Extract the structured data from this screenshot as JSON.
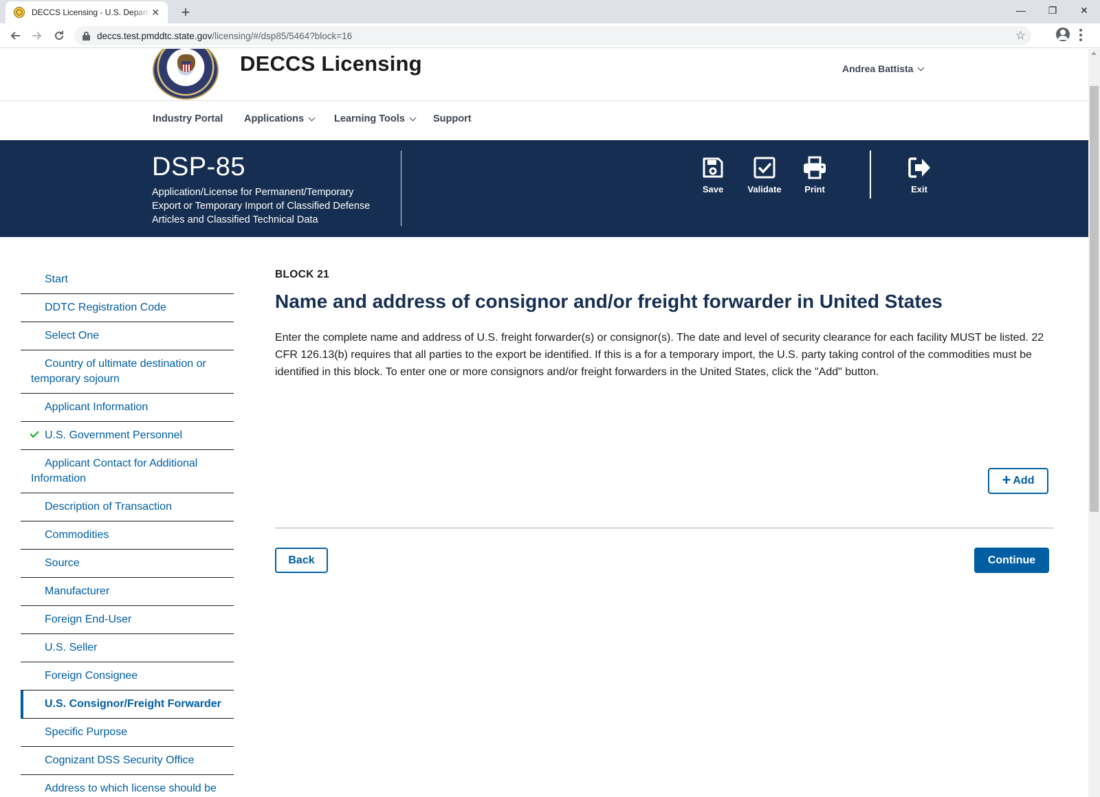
{
  "browser": {
    "tab_title": "DECCS Licensing - U.S. Department of State",
    "tab_close": "✕",
    "new_tab": "+",
    "url_host": "deccs.test.pmddtc.state.gov",
    "url_path": "/licensing/#/dsp85/5464?block=16",
    "window_controls": [
      "—",
      "❐",
      "✕"
    ]
  },
  "header": {
    "site_title": "DECCS Licensing",
    "user_name": "Andrea Battista"
  },
  "nav": {
    "items": [
      {
        "label": "Industry Portal",
        "dropdown": false
      },
      {
        "label": "Applications",
        "dropdown": true
      },
      {
        "label": "Learning Tools",
        "dropdown": true
      },
      {
        "label": "Support",
        "dropdown": false
      }
    ]
  },
  "banner": {
    "form_code": "DSP-85",
    "form_description": "Application/License for Permanent/Temporary Export or Temporary Import of Classified Defense Articles and Classified Technical Data",
    "actions": {
      "save": "Save",
      "validate": "Validate",
      "print": "Print",
      "exit": "Exit"
    }
  },
  "sidenav": {
    "items": [
      {
        "label": "Start"
      },
      {
        "label": "DDTC Registration Code"
      },
      {
        "label": "Select One"
      },
      {
        "label": "Country of ultimate destination or temporary sojourn"
      },
      {
        "label": "Applicant Information"
      },
      {
        "label": "U.S. Government Personnel",
        "complete": true
      },
      {
        "label": "Applicant Contact for Additional Information"
      },
      {
        "label": "Description of Transaction"
      },
      {
        "label": "Commodities"
      },
      {
        "label": "Source"
      },
      {
        "label": "Manufacturer"
      },
      {
        "label": "Foreign End-User"
      },
      {
        "label": "U.S. Seller"
      },
      {
        "label": "Foreign Consignee"
      },
      {
        "label": "U.S. Consignor/Freight Forwarder",
        "current": true
      },
      {
        "label": "Specific Purpose"
      },
      {
        "label": "Cognizant DSS Security Office"
      },
      {
        "label": "Address to which license should be mailed"
      }
    ]
  },
  "main": {
    "block_label": "BLOCK 21",
    "title": "Name and address of consignor and/or freight forwarder in United States",
    "description": "Enter the complete name and address of U.S. freight forwarder(s) or consignor(s). The date and level of security clearance for each facility MUST be listed. 22 CFR 126.13(b) requires that all parties to the export be identified. If this is a for a temporary import, the U.S. party taking control of the commodities must be identified in this block. To enter one or more consignors and/or freight forwarders in the United States, click the \"Add\" button.",
    "add_label": "Add",
    "back_label": "Back",
    "continue_label": "Continue"
  },
  "colors": {
    "banner_bg": "#162e51",
    "link": "#005ea2",
    "check": "#00a91c"
  }
}
